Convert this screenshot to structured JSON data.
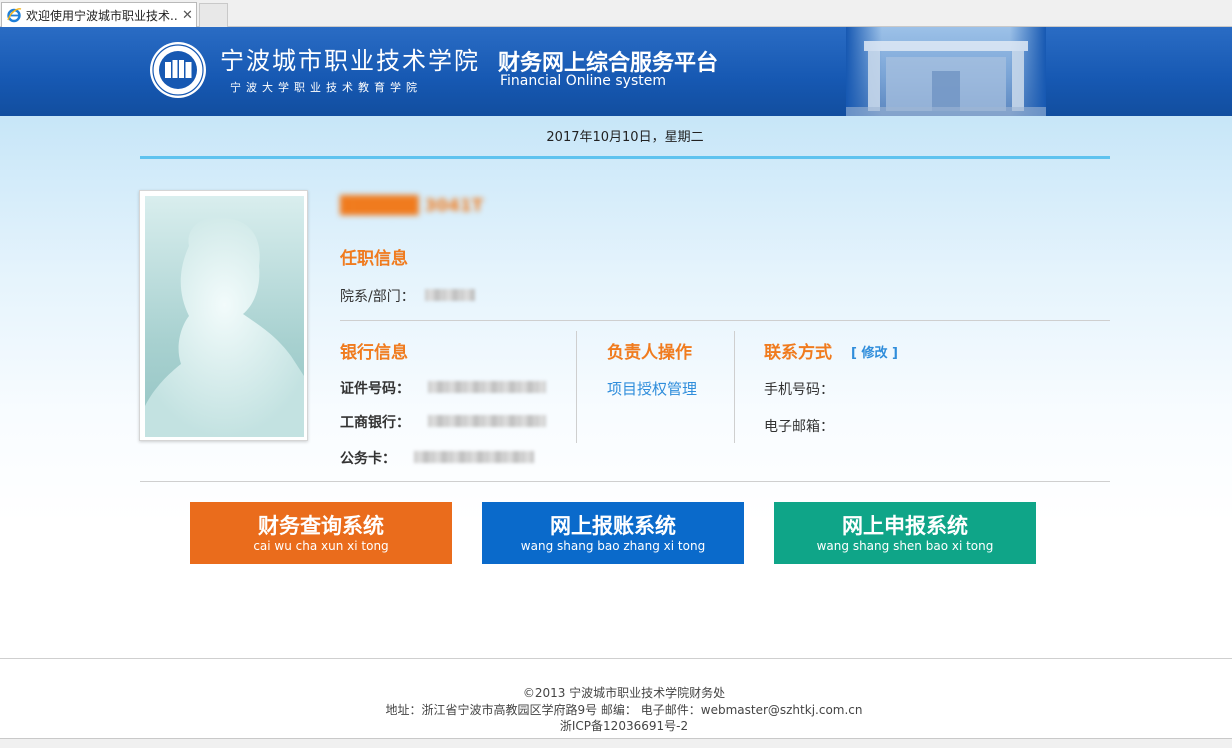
{
  "browser": {
    "tab_title": "欢迎使用宁波城市职业技术...",
    "close_glyph": "✕"
  },
  "header": {
    "school_name": "宁波城市职业技术学院",
    "school_sub": "宁波大学职业技术教育学院",
    "platform_title": "财务网上综合服务平台",
    "platform_sub": "Financial Online system"
  },
  "date": "2017年10月10日，星期二",
  "profile": {
    "name": "██████ 3041T",
    "job_title": "任职信息",
    "dept_label": "院系/部门："
  },
  "bank": {
    "title": "银行信息",
    "id_label": "证件号码：",
    "icbc_label": "工商银行：",
    "card_label": "公务卡："
  },
  "manager": {
    "title": "负责人操作",
    "link": "项目授权管理"
  },
  "contact": {
    "title": "联系方式",
    "edit": "[ 修改 ]",
    "phone_label": "手机号码：",
    "email_label": "电子邮箱："
  },
  "buttons": [
    {
      "cn": "财务查询系统",
      "py": "cai wu cha xun xi tong",
      "color": "#ea6c1c"
    },
    {
      "cn": "网上报账系统",
      "py": "wang shang bao zhang xi tong",
      "color": "#0a6acb"
    },
    {
      "cn": "网上申报系统",
      "py": "wang shang shen bao xi tong",
      "color": "#0fa588"
    }
  ],
  "footer": {
    "copyright": "©2013 宁波城市职业技术学院财务处",
    "address": "地址：浙江省宁波市高教园区学府路9号 邮编： 电子邮件：webmaster@szhtkj.com.cn",
    "icp": "浙ICP备12036691号-2"
  }
}
